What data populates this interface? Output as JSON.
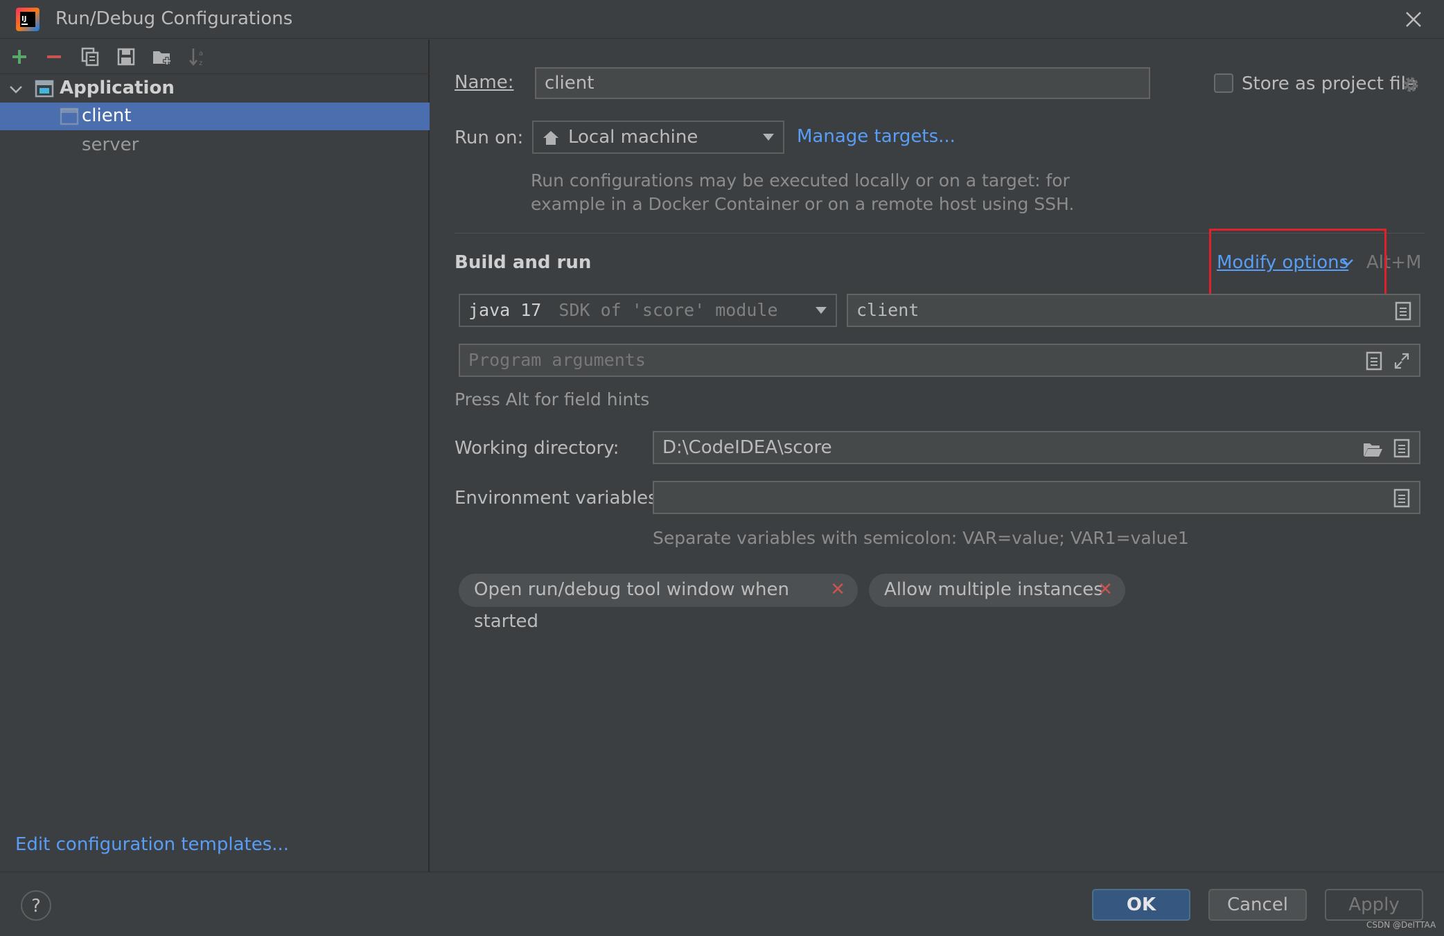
{
  "window": {
    "title": "Run/Debug Configurations"
  },
  "toolbar": {
    "add": "add-icon",
    "remove": "remove-icon",
    "copy": "copy-icon",
    "save": "save-icon",
    "new_folder": "new-folder-icon",
    "sort": "sort-icon"
  },
  "tree": {
    "group_label": "Application",
    "items": [
      {
        "label": "client",
        "selected": true
      },
      {
        "label": "server",
        "selected": false
      }
    ]
  },
  "left_footer": {
    "edit_templates": "Edit configuration templates..."
  },
  "form": {
    "name_label": "Name:",
    "name_value": "client",
    "store_label": "Store as project file",
    "run_on_label": "Run on:",
    "run_on_value": "Local machine",
    "manage_targets": "Manage targets...",
    "run_on_hint_1": "Run configurations may be executed locally or on a target: for",
    "run_on_hint_2": "example in a Docker Container or on a remote host using SSH.",
    "section_title": "Build and run",
    "modify_options": "Modify options",
    "modify_shortcut": "Alt+M",
    "jdk_main": "java 17",
    "jdk_sub": "SDK of 'score' module",
    "main_class": "client",
    "program_args_placeholder": "Program arguments",
    "field_hint": "Press Alt for field hints",
    "workdir_label": "Working directory:",
    "workdir_value": "D:\\CodeIDEA\\score",
    "env_label": "Environment variables:",
    "env_value": "",
    "env_hint": "Separate variables with semicolon: VAR=value; VAR1=value1",
    "chips": [
      {
        "label": "Open run/debug tool window when started"
      },
      {
        "label": "Allow multiple instances"
      }
    ]
  },
  "buttons": {
    "help": "?",
    "ok": "OK",
    "cancel": "Cancel",
    "apply": "Apply"
  },
  "watermark": "CSDN @DelTTAA",
  "colors": {
    "background": "#3c3f41",
    "selection": "#4b6eaf",
    "link": "#589df6",
    "highlight_box": "#e0202a",
    "ok_button": "#365880"
  }
}
